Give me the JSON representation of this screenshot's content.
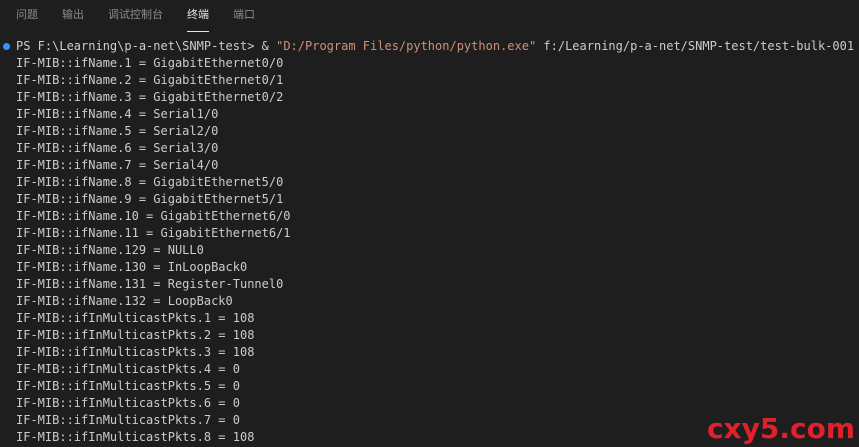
{
  "tabs": [
    {
      "label": "问题",
      "active": false
    },
    {
      "label": "输出",
      "active": false
    },
    {
      "label": "调试控制台",
      "active": false
    },
    {
      "label": "终端",
      "active": true
    },
    {
      "label": "端口",
      "active": false
    }
  ],
  "terminal": {
    "prompt": "PS F:\\Learning\\p-a-net\\SNMP-test> & ",
    "exe": "\"D:/Program Files/python/python.exe\"",
    "script_arg": " f:/Learning/p-a-net/SNMP-test/test-bulk-001",
    "output": [
      "IF-MIB::ifName.1 = GigabitEthernet0/0",
      "IF-MIB::ifName.2 = GigabitEthernet0/1",
      "IF-MIB::ifName.3 = GigabitEthernet0/2",
      "IF-MIB::ifName.4 = Serial1/0",
      "IF-MIB::ifName.5 = Serial2/0",
      "IF-MIB::ifName.6 = Serial3/0",
      "IF-MIB::ifName.7 = Serial4/0",
      "IF-MIB::ifName.8 = GigabitEthernet5/0",
      "IF-MIB::ifName.9 = GigabitEthernet5/1",
      "IF-MIB::ifName.10 = GigabitEthernet6/0",
      "IF-MIB::ifName.11 = GigabitEthernet6/1",
      "IF-MIB::ifName.129 = NULL0",
      "IF-MIB::ifName.130 = InLoopBack0",
      "IF-MIB::ifName.131 = Register-Tunnel0",
      "IF-MIB::ifName.132 = LoopBack0",
      "IF-MIB::ifInMulticastPkts.1 = 108",
      "IF-MIB::ifInMulticastPkts.2 = 108",
      "IF-MIB::ifInMulticastPkts.3 = 108",
      "IF-MIB::ifInMulticastPkts.4 = 0",
      "IF-MIB::ifInMulticastPkts.5 = 0",
      "IF-MIB::ifInMulticastPkts.6 = 0",
      "IF-MIB::ifInMulticastPkts.7 = 0",
      "IF-MIB::ifInMulticastPkts.8 = 108"
    ]
  },
  "watermark": "cxy5.com",
  "colors": {
    "background": "#1e1e1e",
    "text": "#cccccc",
    "string": "#ce9178",
    "status_dot": "#3794ff",
    "watermark": "#e0202a"
  }
}
